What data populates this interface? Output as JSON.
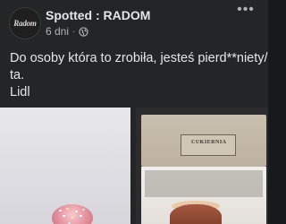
{
  "post": {
    "page_name": "Spotted : RADOM",
    "avatar_text": "Radom",
    "time": "6 dni",
    "separator": "·",
    "privacy_icon": "globe-icon",
    "more_icon": "more-options-icon",
    "more_label": "•••",
    "text_lines": [
      "Do osoby która to zrobiła, jesteś pierd**niety/",
      "ta.",
      "Lidl"
    ],
    "box_label": "CUKIERNIA"
  },
  "colors": {
    "background": "#242526",
    "primary_text": "#e4e6eb",
    "secondary_text": "#b0b3b8"
  }
}
